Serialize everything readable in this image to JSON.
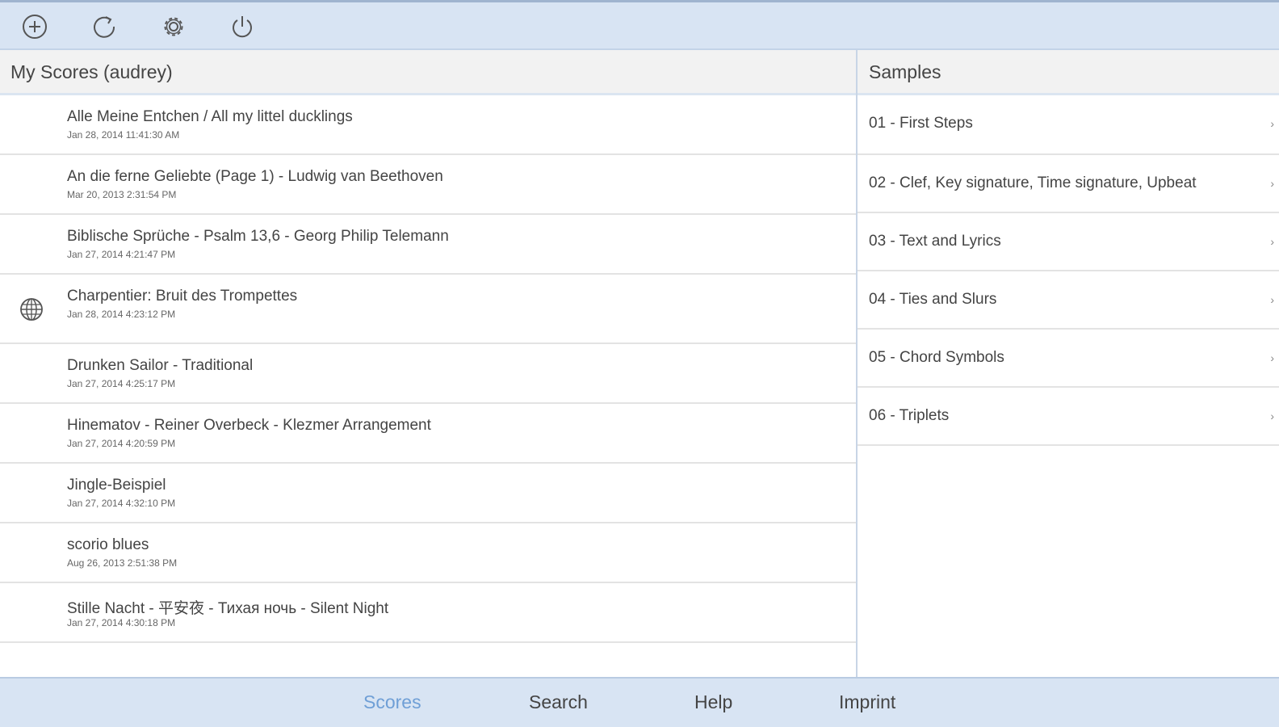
{
  "toolbar": {
    "buttons": [
      {
        "icon": "add-circle-icon"
      },
      {
        "icon": "refresh-icon"
      },
      {
        "icon": "gear-icon"
      },
      {
        "icon": "power-icon"
      }
    ]
  },
  "scores": {
    "header": "My Scores (audrey)",
    "items": [
      {
        "title": "Alle Meine Entchen / All my littel ducklings",
        "date": "Jan 28, 2014 11:41:30 AM"
      },
      {
        "title": "An die ferne Geliebte (Page 1) - Ludwig van Beethoven",
        "date": "Mar 20, 2013 2:31:54 PM"
      },
      {
        "title": "Biblische Sprüche - Psalm 13,6 - Georg Philip Telemann",
        "date": "Jan 27, 2014 4:21:47 PM"
      },
      {
        "title": "Charpentier: Bruit des Trompettes",
        "date": "Jan 28, 2014 4:23:12 PM",
        "icon": "globe-icon"
      },
      {
        "title": "Drunken Sailor - Traditional",
        "date": "Jan 27, 2014 4:25:17 PM"
      },
      {
        "title": "Hinematov - Reiner Overbeck - Klezmer Arrangement",
        "date": "Jan 27, 2014 4:20:59 PM"
      },
      {
        "title": "Jingle-Beispiel",
        "date": "Jan 27, 2014 4:32:10 PM"
      },
      {
        "title": "scorio blues",
        "date": "Aug 26, 2013 2:51:38 PM"
      },
      {
        "title": "Stille Nacht - 平安夜 - Тихая ночь - Silent Night",
        "date": "Jan 27, 2014 4:30:18 PM"
      }
    ]
  },
  "samples": {
    "header": "Samples",
    "items": [
      {
        "label": "01 - First Steps",
        "chevron": "›"
      },
      {
        "label": "02 - Clef, Key signature, Time signature, Upbeat",
        "chevron": "›"
      },
      {
        "label": "03 - Text and Lyrics",
        "chevron": "›"
      },
      {
        "label": "04 - Ties and Slurs",
        "chevron": "›"
      },
      {
        "label": "05 - Chord Symbols",
        "chevron": "›"
      },
      {
        "label": "06 - Triplets",
        "chevron": "›"
      }
    ]
  },
  "bottom_tabs": [
    {
      "label": "Scores",
      "active": true
    },
    {
      "label": "Search",
      "active": false
    },
    {
      "label": "Help",
      "active": false
    },
    {
      "label": "Imprint",
      "active": false
    }
  ],
  "colors": {
    "bar_bg": "#d8e4f3",
    "active_tab": "#6f9fd6"
  }
}
